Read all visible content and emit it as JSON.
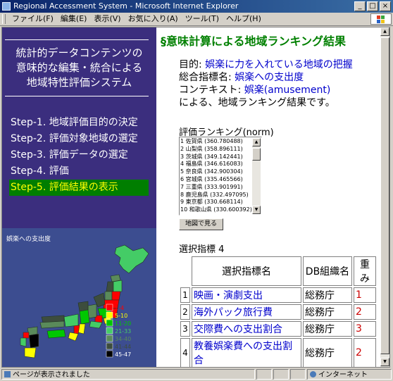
{
  "window": {
    "title": "Regional Accessment System - Microsoft Internet Explorer",
    "controls": [
      "_",
      "□",
      "×"
    ]
  },
  "menu": [
    "ファイル(F)",
    "編集(E)",
    "表示(V)",
    "お気に入り(A)",
    "ツール(T)",
    "ヘルプ(H)"
  ],
  "sidebar": {
    "title_lines": [
      "統計的データコンテンツの",
      "意味的な編集・統合による",
      "地域特性評価システム"
    ],
    "steps": [
      {
        "label": "Step-1. 地域評価目的の決定",
        "active": false
      },
      {
        "label": "Step-2. 評価対象地域の選定",
        "active": false
      },
      {
        "label": "Step-3. 評価データの選定",
        "active": false
      },
      {
        "label": "Step-4. 評価",
        "active": false
      },
      {
        "label": "Step-5. 評価結果の表示",
        "active": true
      }
    ],
    "map_caption": "娯楽への支出度",
    "legend": [
      {
        "label": "1-4",
        "color": "#ff0000"
      },
      {
        "label": "5-10",
        "color": "#ffff00"
      },
      {
        "label": "11-20",
        "color": "#00c800"
      },
      {
        "label": "21-33",
        "color": "#44cc66"
      },
      {
        "label": "34-40",
        "color": "#5a8a5a"
      },
      {
        "label": "41-44",
        "color": "#3d4d3d"
      },
      {
        "label": "45-47",
        "color": "#000000"
      }
    ]
  },
  "main": {
    "section_title": "§意味計算による地域ランキング結果",
    "purpose_label": "目的:",
    "purpose_value": "娯楽に力を入れている地域の把握",
    "index_label": "総合指標名:",
    "index_value": "娯楽への支出度",
    "context_label": "コンテキスト:",
    "context_value": "娯楽(amusement)",
    "result_text": "による、地域ランキング結果です。",
    "ranking_label": "評価ランキング(norm)",
    "ranking": [
      "1 佐賀県 (360.780488)",
      "2 山梨県 (358.896111)",
      "3 茨城県 (349.142441)",
      "4 福島県 (346.616083)",
      "5 奈良県 (342.900304)",
      "6 宮城県 (335.465566)",
      "7 三重県 (333.901991)",
      "8 鹿児島県 (332.497095)",
      "9 東京都 (330.668114)",
      "10 和歌山県 (330.600392)"
    ],
    "map_button": "地図で見る",
    "selected_label": "選択指標 4",
    "table": {
      "headers": [
        "選択指標名",
        "DB組織名",
        "重み"
      ],
      "rows": [
        {
          "no": "1",
          "name": "映画・演劇支出",
          "db": "総務庁",
          "weight": "1"
        },
        {
          "no": "2",
          "name": "海外パック旅行費",
          "db": "総務庁",
          "weight": "2"
        },
        {
          "no": "3",
          "name": "交際費への支出割合",
          "db": "総務庁",
          "weight": "3"
        },
        {
          "no": "4",
          "name": "教養娯楽費への支出割合",
          "db": "総務庁",
          "weight": "2"
        }
      ]
    }
  },
  "status": {
    "text": "ページが表示されました",
    "zone": "インターネット"
  },
  "colors": {
    "sidebar_bg": "#3b2e7e",
    "map_bg": "#3c4d90",
    "active_step_bg": "#007e00",
    "active_step_text": "#ffff00",
    "title_green": "#008000",
    "link_blue": "#0000cc",
    "weight_red": "#cc0000"
  }
}
